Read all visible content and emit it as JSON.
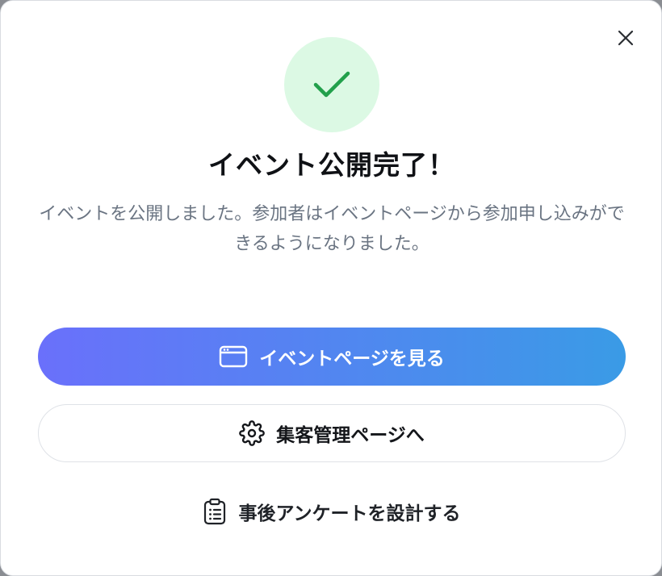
{
  "dialog": {
    "title": "イベント公開完了！",
    "description": "イベントを公開しました。参加者はイベントページから参加申し込みができるようになりました。"
  },
  "icons": {
    "close": "close-icon",
    "success": "check-icon",
    "view_page": "browser-window-icon",
    "manage": "gear-icon",
    "survey": "clipboard-list-icon"
  },
  "actions": {
    "view_event_page": "イベントページを見る",
    "attendee_management": "集客管理ページへ",
    "design_survey": "事後アンケートを設計する"
  },
  "colors": {
    "success_bg": "#dcf9e4",
    "success_check": "#22a04b",
    "primary_gradient_start": "#6a70fb",
    "primary_gradient_end": "#3a9be6",
    "title_text": "#0f1115",
    "description_text": "#6a7482"
  }
}
